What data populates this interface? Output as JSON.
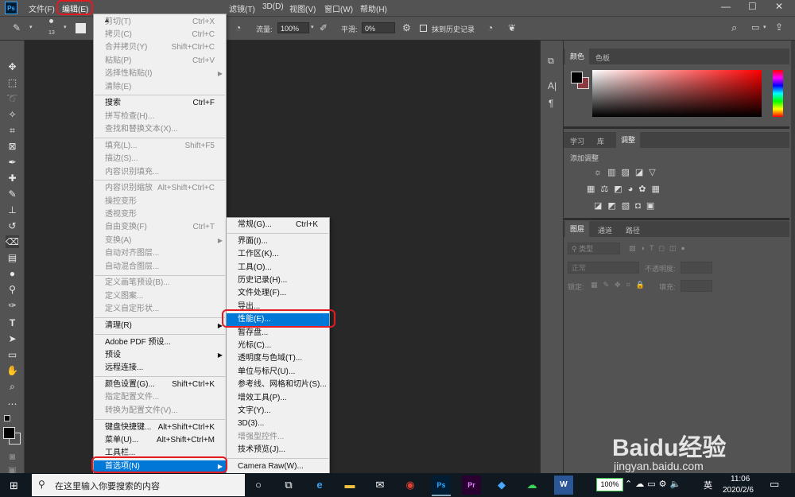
{
  "app": {
    "logo": "Ps"
  },
  "menubar": {
    "items": [
      "文件(F)",
      "编辑(E)",
      "滤镜(T)",
      "3D(D)",
      "视图(V)",
      "窗口(W)",
      "帮助(H)"
    ],
    "controls": {
      "min": "—",
      "max": "☐",
      "close": "✕"
    }
  },
  "options": {
    "brush_size": "13",
    "flow_label": "流量:",
    "flow_value": "100%",
    "smooth_label": "平滑:",
    "smooth_value": "0%",
    "erase_history_label": "抹到历史记录"
  },
  "edit_menu": {
    "scroll_up": "▲",
    "items": [
      {
        "label": "剪切(T)",
        "shortcut": "Ctrl+X",
        "enabled": false
      },
      {
        "label": "拷贝(C)",
        "shortcut": "Ctrl+C",
        "enabled": false
      },
      {
        "label": "合并拷贝(Y)",
        "shortcut": "Shift+Ctrl+C",
        "enabled": false
      },
      {
        "label": "粘贴(P)",
        "shortcut": "Ctrl+V",
        "enabled": false
      },
      {
        "label": "选择性粘贴(I)",
        "shortcut": "",
        "enabled": false,
        "submenu": true
      },
      {
        "label": "清除(E)",
        "shortcut": "",
        "enabled": false
      },
      {
        "label": "搜索",
        "shortcut": "Ctrl+F",
        "enabled": true
      },
      {
        "label": "拼写检查(H)...",
        "shortcut": "",
        "enabled": false
      },
      {
        "label": "查找和替换文本(X)...",
        "shortcut": "",
        "enabled": false
      },
      {
        "label": "填充(L)...",
        "shortcut": "Shift+F5",
        "enabled": false
      },
      {
        "label": "描边(S)...",
        "shortcut": "",
        "enabled": false
      },
      {
        "label": "内容识别填充...",
        "shortcut": "",
        "enabled": false
      },
      {
        "label": "内容识别缩放",
        "shortcut": "Alt+Shift+Ctrl+C",
        "enabled": false
      },
      {
        "label": "操控变形",
        "shortcut": "",
        "enabled": false
      },
      {
        "label": "透视变形",
        "shortcut": "",
        "enabled": false
      },
      {
        "label": "自由变换(F)",
        "shortcut": "Ctrl+T",
        "enabled": false
      },
      {
        "label": "变换(A)",
        "shortcut": "",
        "enabled": false,
        "submenu": true
      },
      {
        "label": "自动对齐图层...",
        "shortcut": "",
        "enabled": false
      },
      {
        "label": "自动混合图层...",
        "shortcut": "",
        "enabled": false
      },
      {
        "label": "定义画笔预设(B)...",
        "shortcut": "",
        "enabled": false
      },
      {
        "label": "定义图案...",
        "shortcut": "",
        "enabled": false
      },
      {
        "label": "定义自定形状...",
        "shortcut": "",
        "enabled": false
      },
      {
        "label": "清理(R)",
        "shortcut": "",
        "enabled": true,
        "submenu": true
      },
      {
        "label": "Adobe PDF 预设...",
        "shortcut": "",
        "enabled": true
      },
      {
        "label": "预设",
        "shortcut": "",
        "enabled": true,
        "submenu": true
      },
      {
        "label": "远程连接...",
        "shortcut": "",
        "enabled": true
      },
      {
        "label": "颜色设置(G)...",
        "shortcut": "Shift+Ctrl+K",
        "enabled": true
      },
      {
        "label": "指定配置文件...",
        "shortcut": "",
        "enabled": false
      },
      {
        "label": "转换为配置文件(V)...",
        "shortcut": "",
        "enabled": false
      },
      {
        "label": "键盘快捷键...",
        "shortcut": "Alt+Shift+Ctrl+K",
        "enabled": true
      },
      {
        "label": "菜单(U)...",
        "shortcut": "Alt+Shift+Ctrl+M",
        "enabled": true
      },
      {
        "label": "工具栏...",
        "shortcut": "",
        "enabled": true
      },
      {
        "label": "首选项(N)",
        "shortcut": "",
        "enabled": true,
        "submenu": true,
        "highlighted": true
      }
    ]
  },
  "prefs_menu": {
    "items": [
      {
        "label": "常规(G)...",
        "shortcut": "Ctrl+K",
        "enabled": true
      },
      {
        "label": "界面(I)...",
        "shortcut": "",
        "enabled": true
      },
      {
        "label": "工作区(K)...",
        "shortcut": "",
        "enabled": true
      },
      {
        "label": "工具(O)...",
        "shortcut": "",
        "enabled": true
      },
      {
        "label": "历史记录(H)...",
        "shortcut": "",
        "enabled": true
      },
      {
        "label": "文件处理(F)...",
        "shortcut": "",
        "enabled": true
      },
      {
        "label": "导出...",
        "shortcut": "",
        "enabled": true
      },
      {
        "label": "性能(E)...",
        "shortcut": "",
        "enabled": true,
        "highlighted": true
      },
      {
        "label": "暂存盘...",
        "shortcut": "",
        "enabled": true
      },
      {
        "label": "光标(C)...",
        "shortcut": "",
        "enabled": true
      },
      {
        "label": "透明度与色域(T)...",
        "shortcut": "",
        "enabled": true
      },
      {
        "label": "单位与标尺(U)...",
        "shortcut": "",
        "enabled": true
      },
      {
        "label": "参考线、网格和切片(S)...",
        "shortcut": "",
        "enabled": true
      },
      {
        "label": "增效工具(P)...",
        "shortcut": "",
        "enabled": true
      },
      {
        "label": "文字(Y)...",
        "shortcut": "",
        "enabled": true
      },
      {
        "label": "3D(3)...",
        "shortcut": "",
        "enabled": true
      },
      {
        "label": "增强型控件...",
        "shortcut": "",
        "enabled": false
      },
      {
        "label": "技术预览(J)...",
        "shortcut": "",
        "enabled": true
      },
      {
        "label": "Camera Raw(W)...",
        "shortcut": "",
        "enabled": true
      }
    ]
  },
  "color_panel": {
    "tabs": [
      "颜色",
      "色板"
    ],
    "fg_color": "#000000",
    "bg_color": "#8b3a3f"
  },
  "adjust_panel": {
    "tabs": [
      "学习",
      "库",
      "调整"
    ],
    "title": "添加调整"
  },
  "layers_panel": {
    "tabs": [
      "图层",
      "通道",
      "路径"
    ],
    "filter_placeholder": "类型",
    "blend_mode": "正常",
    "opacity_label": "不透明度:",
    "lock_label": "锁定:",
    "fill_label": "填充:"
  },
  "taskbar": {
    "search_placeholder": "在这里输入你要搜索的内容",
    "battery": "100%",
    "ime": "英",
    "time": "11:06",
    "date": "2020/2/6"
  },
  "watermark": {
    "brand": "Baidu经验",
    "url": "jingyan.baidu.com"
  }
}
